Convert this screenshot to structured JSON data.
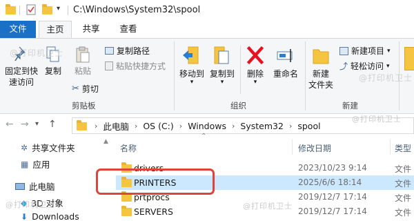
{
  "title_bar": {
    "path": "C:\\Windows\\System32\\spool"
  },
  "ribbon_tabs": {
    "file": "文件",
    "home": "主页",
    "share": "共享",
    "view": "查看"
  },
  "clipboard": {
    "pin": [
      "固定到快",
      "速访问"
    ],
    "copy": "复制",
    "paste": "粘贴",
    "copy_path": "复制路径",
    "paste_shortcut": "粘贴快捷方式",
    "cut": "剪切",
    "label": "剪贴板"
  },
  "organize": {
    "move_to": "移动到",
    "copy_to": "复制到",
    "delete": "删除",
    "rename": "重命名",
    "label": "组织"
  },
  "new": {
    "new_folder": [
      "新建",
      "文件夹"
    ],
    "new_item": "新建项目",
    "easy_access": "轻松访问",
    "label": "新建"
  },
  "watermark": "@打印机卫士",
  "breadcrumb": [
    "此电脑",
    "OS (C:)",
    "Windows",
    "System32",
    "spool"
  ],
  "nav_pane": [
    {
      "label": "共享文件夹",
      "icon": "share-icon"
    },
    {
      "label": "应用",
      "icon": "apps-icon"
    },
    {
      "label": "此电脑",
      "icon": "computer-icon"
    },
    {
      "label": "3D 对象",
      "icon": "3d-objects-icon"
    },
    {
      "label": "Downloads",
      "icon": "downloads-icon"
    }
  ],
  "columns": {
    "name": "名称",
    "modified": "修改日期",
    "type": "类型"
  },
  "files": [
    {
      "name": "drivers",
      "modified": "2023/10/23 9:14",
      "type": "文件"
    },
    {
      "name": "PRINTERS",
      "modified": "2025/6/6 18:14",
      "type": "文件",
      "selected": true
    },
    {
      "name": "prtprocs",
      "modified": "2019/12/7 17:14",
      "type": "文件"
    },
    {
      "name": "SERVERS",
      "modified": "2019/12/7 17:14",
      "type": "文件"
    }
  ],
  "colors": {
    "accent": "#1a6fc7",
    "selection": "#cce8ff",
    "highlight": "#e0433a",
    "folder": "#f5c542",
    "delete_red": "#e81123"
  }
}
